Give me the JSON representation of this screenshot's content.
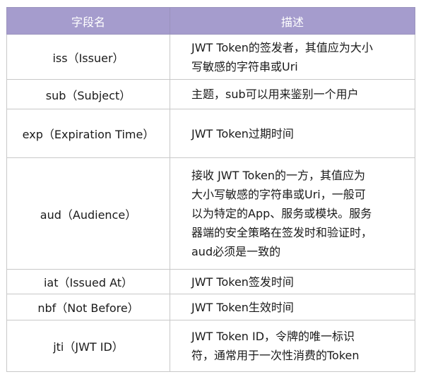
{
  "table": {
    "headers": [
      "字段名",
      "描述"
    ],
    "rows": [
      {
        "field": "iss（Issuer）",
        "desc_lines": [
          "JWT Token的签发者，其值应为大小",
          "写敏感的字符串或Uri"
        ]
      },
      {
        "field": "sub（Subject）",
        "desc_lines": [
          "主题，sub可以用来鉴别一个用户"
        ]
      },
      {
        "field": "exp（Expiration Time）",
        "desc_lines": [
          "JWT Token过期时间"
        ]
      },
      {
        "field": "aud（Audience）",
        "desc_lines": [
          "接收 JWT Token的一方，其值应为",
          "大小写敏感的字符串或Uri，一般可",
          "以为特定的App、服务或模块。服务",
          "器端的安全策略在签发时和验证时，",
          "aud必须是一致的"
        ]
      },
      {
        "field": "iat（Issued At）",
        "desc_lines": [
          "JWT Token签发时间"
        ]
      },
      {
        "field": "nbf（Not Before）",
        "desc_lines": [
          "JWT Token生效时间"
        ]
      },
      {
        "field": "jti（JWT ID）",
        "desc_lines": [
          "JWT Token ID，令牌的唯一标识",
          "符，通常用于一次性消费的Token"
        ]
      }
    ]
  }
}
